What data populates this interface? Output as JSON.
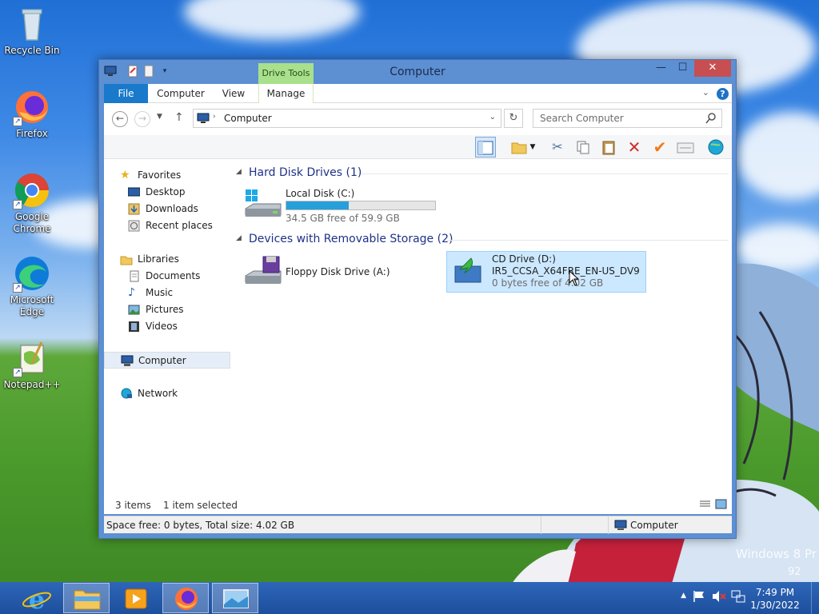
{
  "desktop": {
    "icons": [
      {
        "label": "Recycle Bin",
        "icon": "recycle-bin-icon"
      },
      {
        "label": "Firefox",
        "icon": "firefox-icon"
      },
      {
        "label": "Google Chrome",
        "icon": "chrome-icon"
      },
      {
        "label": "Microsoft Edge",
        "icon": "edge-icon"
      },
      {
        "label": "Notepad++",
        "icon": "notepadpp-icon"
      }
    ],
    "watermark": "Windows 8 Pr",
    "watermark2": "92"
  },
  "window": {
    "title": "Computer",
    "context_tab": "Drive Tools",
    "controls": {
      "minimize": "—",
      "maximize": "☐",
      "close": "✕"
    },
    "tabs": [
      {
        "label": "File"
      },
      {
        "label": "Computer"
      },
      {
        "label": "View"
      },
      {
        "label": "Manage"
      }
    ],
    "help_label": "?",
    "address": {
      "path": "Computer"
    },
    "search": {
      "placeholder": "Search Computer"
    }
  },
  "nav_pane": {
    "favorites": {
      "label": "Favorites",
      "items": [
        "Desktop",
        "Downloads",
        "Recent places"
      ]
    },
    "libraries": {
      "label": "Libraries",
      "items": [
        "Documents",
        "Music",
        "Pictures",
        "Videos"
      ]
    },
    "computer": "Computer",
    "network": "Network"
  },
  "main": {
    "groups": [
      {
        "title": "Hard Disk Drives (1)",
        "drives": [
          {
            "name": "Local Disk (C:)",
            "free": "34.5 GB free of 59.9 GB",
            "used_fraction": 0.42
          }
        ]
      },
      {
        "title": "Devices with Removable Storage (2)",
        "drives": [
          {
            "name": "Floppy Disk Drive (A:)"
          },
          {
            "name": "CD Drive (D:)",
            "label": "IR5_CCSA_X64FRE_EN-US_DV9",
            "free": "0 bytes free of 4.02 GB"
          }
        ]
      }
    ]
  },
  "status": {
    "items": "3 items",
    "selected": "1 item selected",
    "details": "Space free: 0 bytes, Total size: 4.02 GB",
    "location": "Computer"
  },
  "taskbar": {
    "time": "7:49 PM",
    "date": "1/30/2022"
  },
  "colors": {
    "accent": "#1979ca",
    "selection": "#cce8ff",
    "progress": "#26a0da"
  }
}
